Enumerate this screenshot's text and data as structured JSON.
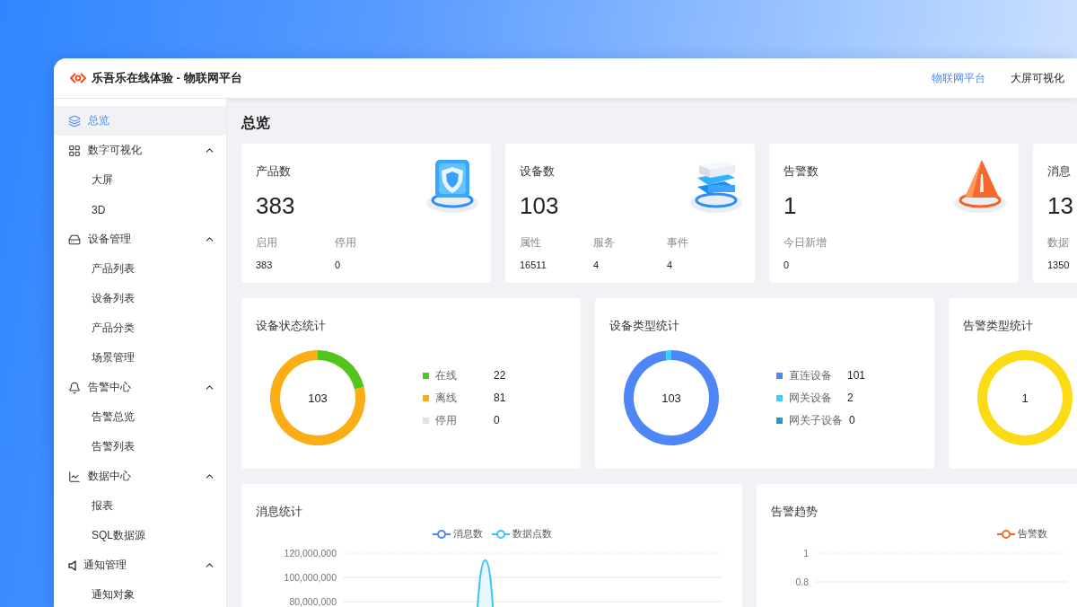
{
  "header": {
    "logo_text": "乐吾乐在线体验 - 物联网平台",
    "nav": [
      {
        "label": "物联网平台",
        "selected": true
      },
      {
        "label": "大屏可视化",
        "selected": false
      }
    ]
  },
  "sidebar": {
    "items": [
      {
        "label": "总览",
        "kind": "layers",
        "selected": true
      },
      {
        "label": "数字可视化",
        "kind": "grid",
        "selected": false,
        "expanded": true,
        "children": [
          {
            "label": "大屏",
            "selected": false
          },
          {
            "label": "3D",
            "selected": false
          }
        ]
      },
      {
        "label": "设备管理",
        "kind": "drive",
        "selected": false,
        "expanded": true,
        "children": [
          {
            "label": "产品列表",
            "selected": false
          },
          {
            "label": "设备列表",
            "selected": false
          },
          {
            "label": "产品分类",
            "selected": false
          },
          {
            "label": "场景管理",
            "selected": false
          }
        ]
      },
      {
        "label": "告警中心",
        "kind": "bell",
        "selected": false,
        "expanded": true,
        "children": [
          {
            "label": "告警总览",
            "selected": false
          },
          {
            "label": "告警列表",
            "selected": false
          }
        ]
      },
      {
        "label": "数据中心",
        "kind": "chart",
        "selected": false,
        "expanded": true,
        "children": [
          {
            "label": "报表",
            "selected": false
          },
          {
            "label": "SQL数据源",
            "selected": false
          }
        ]
      },
      {
        "label": "通知管理",
        "kind": "speaker",
        "selected": false,
        "expanded": true,
        "children": [
          {
            "label": "通知对象",
            "selected": false
          }
        ]
      }
    ]
  },
  "page_title": "总览",
  "stat_cards": [
    {
      "title": "产品数",
      "value": "383",
      "kind": "shield",
      "stats": [
        {
          "label": "启用",
          "value": "383"
        },
        {
          "label": "停用",
          "value": "0"
        }
      ]
    },
    {
      "title": "设备数",
      "value": "103",
      "kind": "server",
      "stats": [
        {
          "label": "属性",
          "value": "16511"
        },
        {
          "label": "服务",
          "value": "4"
        },
        {
          "label": "事件",
          "value": "4"
        }
      ]
    },
    {
      "title": "告警数",
      "value": "1",
      "kind": "warning",
      "stats": [
        {
          "label": "今日新增",
          "value": "0"
        }
      ]
    },
    {
      "title": "消息",
      "value": "13",
      "stats": [
        {
          "label": "数据",
          "value": "1350"
        }
      ]
    }
  ],
  "distribution_cards": [
    {
      "title": "设备状态统计",
      "center": "103",
      "legend": [
        {
          "label": "在线",
          "value": "22",
          "color": "#52c41a"
        },
        {
          "label": "离线",
          "value": "81",
          "color": "#faad14"
        },
        {
          "label": "停用",
          "value": "0",
          "color": "#e3e3e3"
        }
      ]
    },
    {
      "title": "设备类型统计",
      "center": "103",
      "legend": [
        {
          "label": "直连设备",
          "value": "101",
          "color": "#4e86f7"
        },
        {
          "label": "网关设备",
          "value": "2",
          "color": "#36cfff"
        },
        {
          "label": "网关子设备",
          "value": "0",
          "color": "#1a9be0"
        }
      ]
    },
    {
      "title": "告警类型统计",
      "center": "1"
    }
  ],
  "trend_cards": [
    {
      "title": "消息统计",
      "legend": [
        {
          "label": "消息数",
          "color": "#4e86f7"
        },
        {
          "label": "数据点数",
          "color": "#3ec1f7"
        }
      ],
      "y_labels": [
        "120,000,000",
        "100,000,000",
        "80,000,000"
      ]
    },
    {
      "title": "告警趋势",
      "legend": [
        {
          "label": "告警数",
          "color": "#f06a2e"
        }
      ],
      "y_labels": [
        "1",
        "0.8"
      ]
    }
  ]
}
